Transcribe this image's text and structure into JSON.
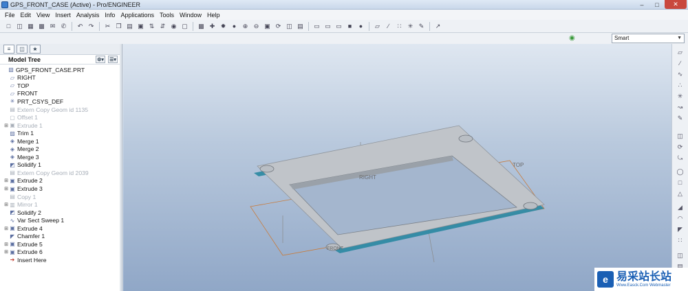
{
  "window": {
    "title": "GPS_FRONT_CASE (Active) - Pro/ENGINEER"
  },
  "menu": [
    "File",
    "Edit",
    "View",
    "Insert",
    "Analysis",
    "Info",
    "Applications",
    "Tools",
    "Window",
    "Help"
  ],
  "selection_filter": {
    "value": "Smart"
  },
  "model_tree": {
    "header": "Model Tree",
    "items": [
      {
        "label": "GPS_FRONT_CASE.PRT",
        "icon": "part-icon",
        "state": "normal",
        "expand": false
      },
      {
        "label": "RIGHT",
        "icon": "datum-plane-icon",
        "state": "normal",
        "expand": false
      },
      {
        "label": "TOP",
        "icon": "datum-plane-icon",
        "state": "normal",
        "expand": false
      },
      {
        "label": "FRONT",
        "icon": "datum-plane-icon",
        "state": "normal",
        "expand": false
      },
      {
        "label": "PRT_CSYS_DEF",
        "icon": "csys-icon",
        "state": "normal",
        "expand": false
      },
      {
        "label": "Extern Copy Geom id 1135",
        "icon": "copy-geom-icon",
        "state": "suppressed",
        "expand": false
      },
      {
        "label": "Offset 1",
        "icon": "offset-icon",
        "state": "suppressed",
        "expand": false
      },
      {
        "label": "Extrude 1",
        "icon": "extrude-icon",
        "state": "suppressed",
        "expand": true
      },
      {
        "label": "Trim 1",
        "icon": "trim-icon",
        "state": "normal",
        "expand": false
      },
      {
        "label": "Merge 1",
        "icon": "merge-icon",
        "state": "normal",
        "expand": false
      },
      {
        "label": "Merge 2",
        "icon": "merge-icon",
        "state": "normal",
        "expand": false
      },
      {
        "label": "Merge 3",
        "icon": "merge-icon",
        "state": "normal",
        "expand": false
      },
      {
        "label": "Solidify 1",
        "icon": "solidify-icon",
        "state": "normal",
        "expand": false
      },
      {
        "label": "Extern Copy Geom id 2039",
        "icon": "copy-geom-icon",
        "state": "suppressed",
        "expand": false
      },
      {
        "label": "Extrude 2",
        "icon": "extrude-icon",
        "state": "normal",
        "expand": true
      },
      {
        "label": "Extrude 3",
        "icon": "extrude-icon",
        "state": "normal",
        "expand": true
      },
      {
        "label": "Copy 1",
        "icon": "copy-icon",
        "state": "suppressed",
        "expand": false
      },
      {
        "label": "Mirror 1",
        "icon": "mirror-icon",
        "state": "suppressed",
        "expand": true
      },
      {
        "label": "Solidify 2",
        "icon": "solidify-icon",
        "state": "normal",
        "expand": false
      },
      {
        "label": "Var Sect Sweep 1",
        "icon": "sweep-icon",
        "state": "normal",
        "expand": false
      },
      {
        "label": "Extrude 4",
        "icon": "extrude-icon",
        "state": "normal",
        "expand": true
      },
      {
        "label": "Chamfer 1",
        "icon": "chamfer-icon",
        "state": "normal",
        "expand": false
      },
      {
        "label": "Extrude 5",
        "icon": "extrude-icon",
        "state": "normal",
        "expand": true
      },
      {
        "label": "Extrude 6",
        "icon": "extrude-icon",
        "state": "normal",
        "expand": true
      },
      {
        "label": "Insert Here",
        "icon": "insert-arrow-icon",
        "state": "normal",
        "expand": false
      }
    ]
  },
  "viewport": {
    "datum_labels": {
      "right": "RIGHT",
      "top": "TOP",
      "front": "FRONT"
    },
    "colors": {
      "frame_top": "#c0c4c9",
      "frame_edge": "#2f8aa3",
      "datum": "#c97b3a"
    }
  },
  "watermark": {
    "text_cn": "易采站长站",
    "text_en": "Www.Easck.Com Webmaster"
  }
}
